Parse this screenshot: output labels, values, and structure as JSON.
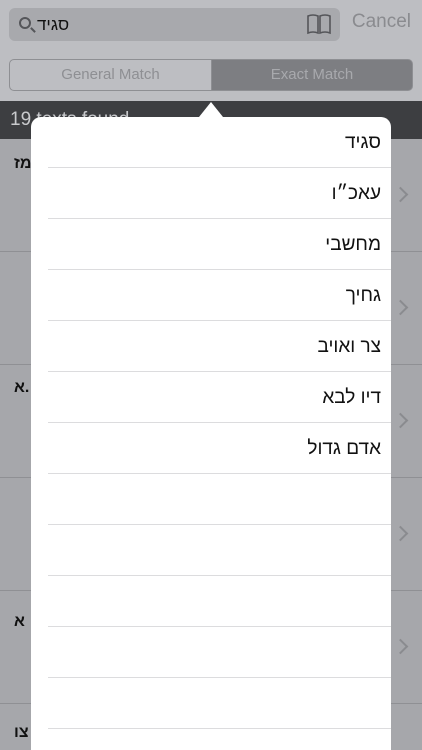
{
  "search": {
    "value": "סגיד",
    "icon": "search-icon",
    "book_icon": "book-icon"
  },
  "cancel_label": "Cancel",
  "segments": {
    "general": "General Match",
    "exact": "Exact Match"
  },
  "results_header": "19 texts found",
  "background_rows": [
    "מז",
    "א.",
    "א",
    "צו"
  ],
  "popover": {
    "items": [
      "סגיד",
      "עאכ״ו",
      "מחשבי",
      "גחיך",
      "צר ואויב",
      "דיו לבא",
      "אדם גדול"
    ]
  },
  "colors": {
    "accent": "#3d3e41",
    "dim_overlay": "#a6a7ab"
  }
}
